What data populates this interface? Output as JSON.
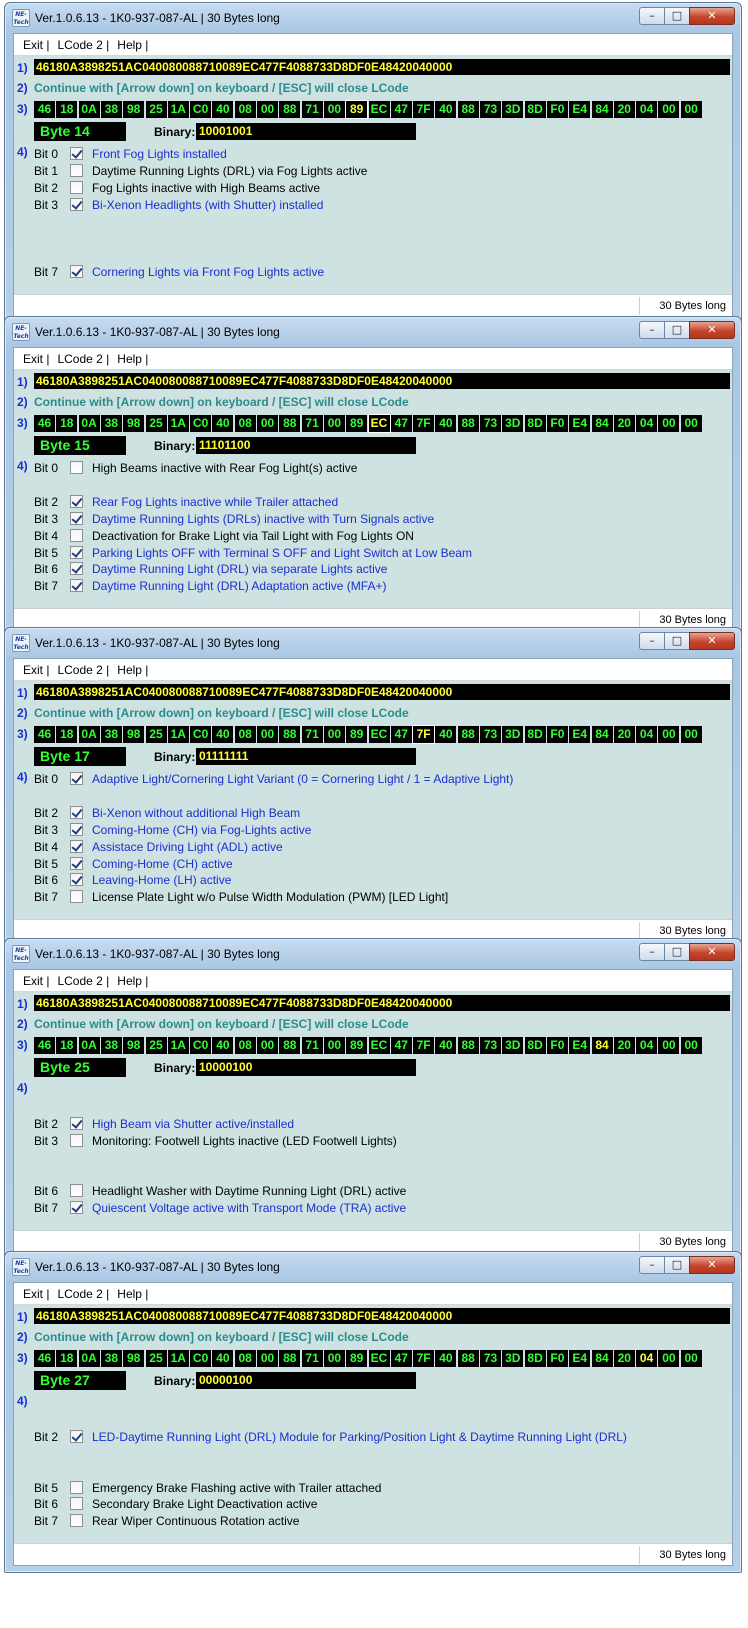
{
  "app": {
    "title": "Ver.1.0.6.13 -   1K0-937-087-AL | 30 Bytes long",
    "icon_text": "NE-Tech",
    "menu": [
      "Exit |",
      "LCode 2 |",
      "Help |"
    ],
    "status": "30 Bytes long",
    "code": "46180A3898251AC040080088710089EC477F4088733D8DF0E48420040000",
    "continue_text": "Continue with [Arrow down] on keyboard / [ESC] will close LCode",
    "binary_caption": "Binary:",
    "step_labels": [
      "1)",
      "2)",
      "3)",
      "4)"
    ],
    "bytes": [
      "46",
      "18",
      "0A",
      "38",
      "98",
      "25",
      "1A",
      "C0",
      "40",
      "08",
      "00",
      "88",
      "71",
      "00",
      "89",
      "EC",
      "47",
      "7F",
      "40",
      "88",
      "73",
      "3D",
      "8D",
      "F0",
      "E4",
      "84",
      "20",
      "04",
      "00",
      "00"
    ],
    "colors": {
      "accent_green": "#33ff33",
      "accent_yellow": "#ffff33",
      "active_blue": "#1a2fd0",
      "teal": "#2a8c8c"
    }
  },
  "windows": [
    {
      "byte_label": "Byte 14",
      "selected_index": 14,
      "binary": "10001001",
      "bits": [
        {
          "bit": "Bit 0",
          "row": 0,
          "checked": true,
          "text": "Front Fog Lights installed"
        },
        {
          "bit": "Bit 1",
          "row": 1,
          "checked": false,
          "text": "Daytime Running Lights (DRL) via Fog Lights active"
        },
        {
          "bit": "Bit 2",
          "row": 2,
          "checked": false,
          "text": "Fog Lights inactive with High Beams active"
        },
        {
          "bit": "Bit 3",
          "row": 3,
          "checked": true,
          "text": "Bi-Xenon Headlights (with Shutter) installed"
        },
        {
          "bit": "Bit 7",
          "row": 7,
          "checked": true,
          "text": "Cornering Lights via Front Fog Lights active"
        }
      ]
    },
    {
      "byte_label": "Byte 15",
      "selected_index": 15,
      "binary": "11101100",
      "bits": [
        {
          "bit": "Bit 0",
          "row": 0,
          "checked": false,
          "text": "High Beams inactive with Rear Fog Light(s) active"
        },
        {
          "bit": "Bit 2",
          "row": 2,
          "checked": true,
          "text": "Rear Fog Lights inactive while Trailer attached"
        },
        {
          "bit": "Bit 3",
          "row": 3,
          "checked": true,
          "text": "Daytime Running Lights (DRLs) inactive with Turn Signals active"
        },
        {
          "bit": "Bit 4",
          "row": 4,
          "checked": false,
          "text": "Deactivation for Brake Light via Tail Light with Fog Lights ON"
        },
        {
          "bit": "Bit 5",
          "row": 5,
          "checked": true,
          "text": "Parking Lights OFF with Terminal S OFF and Light Switch at Low Beam"
        },
        {
          "bit": "Bit 6",
          "row": 6,
          "checked": true,
          "text": "Daytime Running Light (DRL) via separate Lights active"
        },
        {
          "bit": "Bit 7",
          "row": 7,
          "checked": true,
          "text": "Daytime Running Light (DRL) Adaptation active (MFA+)"
        }
      ]
    },
    {
      "byte_label": "Byte 17",
      "selected_index": 17,
      "binary": "01111111",
      "bits": [
        {
          "bit": "Bit 0",
          "row": 0,
          "checked": true,
          "text": "Adaptive Light/Cornering Light Variant (0 = Cornering Light / 1 = Adaptive Light)"
        },
        {
          "bit": "Bit 2",
          "row": 2,
          "checked": true,
          "text": "Bi-Xenon without additional High Beam"
        },
        {
          "bit": "Bit 3",
          "row": 3,
          "checked": true,
          "text": "Coming-Home (CH) via Fog-Lights active"
        },
        {
          "bit": "Bit 4",
          "row": 4,
          "checked": true,
          "text": "Assistace Driving Light (ADL) active"
        },
        {
          "bit": "Bit 5",
          "row": 5,
          "checked": true,
          "text": "Coming-Home (CH) active"
        },
        {
          "bit": "Bit 6",
          "row": 6,
          "checked": true,
          "text": "Leaving-Home (LH) active"
        },
        {
          "bit": "Bit 7",
          "row": 7,
          "checked": false,
          "text": "License Plate Light w/o Pulse Width Modulation (PWM) [LED Light]"
        }
      ]
    },
    {
      "byte_label": "Byte 25",
      "selected_index": 25,
      "binary": "10000100",
      "bits": [
        {
          "bit": "Bit 2",
          "row": 2,
          "checked": true,
          "text": "High Beam via Shutter active/installed"
        },
        {
          "bit": "Bit 3",
          "row": 3,
          "checked": false,
          "text": "Monitoring: Footwell Lights inactive (LED Footwell Lights)"
        },
        {
          "bit": "Bit 6",
          "row": 6,
          "checked": false,
          "text": "Headlight Washer with Daytime Running Light (DRL) active"
        },
        {
          "bit": "Bit 7",
          "row": 7,
          "checked": true,
          "text": "Quiescent Voltage active with Transport Mode (TRA) active"
        }
      ]
    },
    {
      "byte_label": "Byte 27",
      "selected_index": 27,
      "binary": "00000100",
      "bits": [
        {
          "bit": "Bit 2",
          "row": 2,
          "checked": true,
          "text": "LED-Daytime Running Light (DRL) Module for Parking/Position Light & Daytime Running Light (DRL)"
        },
        {
          "bit": "Bit 5",
          "row": 5,
          "checked": false,
          "text": "Emergency Brake Flashing active with Trailer attached"
        },
        {
          "bit": "Bit 6",
          "row": 6,
          "checked": false,
          "text": "Secondary Brake Light Deactivation active"
        },
        {
          "bit": "Bit 7",
          "row": 7,
          "checked": false,
          "text": "Rear Wiper Continuous Rotation active"
        }
      ]
    }
  ]
}
